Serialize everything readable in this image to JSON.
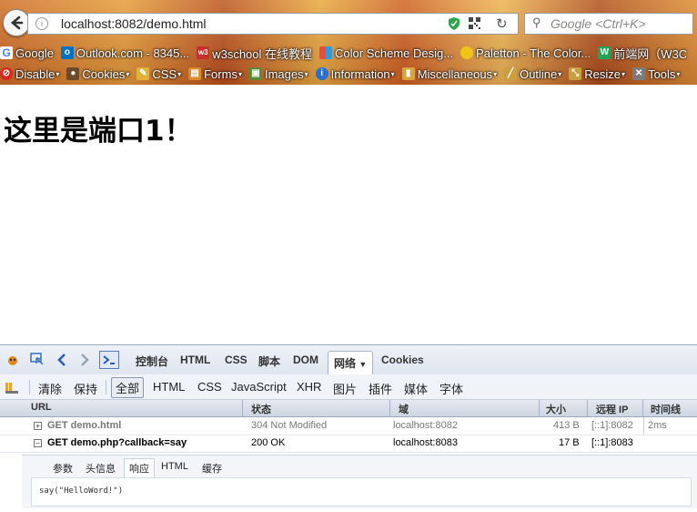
{
  "browser": {
    "url": "localhost:8082/demo.html",
    "search_placeholder": "Google <Ctrl+K>",
    "bookmarks": [
      {
        "label": "Google",
        "icon": "google-icon",
        "color": "#4285f4"
      },
      {
        "label": "Outlook.com - 8345...",
        "icon": "outlook-icon",
        "color": "#0072c6"
      },
      {
        "label": "w3school 在线教程",
        "icon": "w3school-icon",
        "color": "#c4302b"
      },
      {
        "label": "Color Scheme Desig...",
        "icon": "color-scheme-icon",
        "color": "#e84c3d"
      },
      {
        "label": "Paletton - The Color...",
        "icon": "paletton-icon",
        "color": "#f0c419"
      },
      {
        "label": "前端网（W3C",
        "icon": "w3cfuns-icon",
        "color": "#22a35a"
      }
    ],
    "webdev_toolbar": [
      {
        "label": "Disable",
        "icon": "disable-icon"
      },
      {
        "label": "Cookies",
        "icon": "cookies-icon"
      },
      {
        "label": "CSS",
        "icon": "css-icon"
      },
      {
        "label": "Forms",
        "icon": "forms-icon"
      },
      {
        "label": "Images",
        "icon": "images-icon"
      },
      {
        "label": "Information",
        "icon": "information-icon"
      },
      {
        "label": "Miscellaneous",
        "icon": "miscellaneous-icon"
      },
      {
        "label": "Outline",
        "icon": "outline-icon"
      },
      {
        "label": "Resize",
        "icon": "resize-icon"
      },
      {
        "label": "Tools",
        "icon": "tools-icon"
      }
    ]
  },
  "page": {
    "heading": "这里是端口1！"
  },
  "firebug": {
    "tabs": [
      "控制台",
      "HTML",
      "CSS",
      "脚本",
      "DOM",
      "网络",
      "Cookies"
    ],
    "active_tab": "网络",
    "filters": [
      "清除",
      "保持",
      "全部",
      "HTML",
      "CSS",
      "JavaScript",
      "XHR",
      "图片",
      "插件",
      "媒体",
      "字体"
    ],
    "active_filter": "全部",
    "columns": [
      "URL",
      "状态",
      "域",
      "大小",
      "远程 IP",
      "时间线"
    ],
    "requests": [
      {
        "url": "GET demo.html",
        "status": "304 Not Modified",
        "domain": "localhost:8082",
        "size": "413 B",
        "remote_ip": "[::1]:8082",
        "time": "2ms",
        "expanded": false
      },
      {
        "url": "GET demo.php?callback=say",
        "status": "200 OK",
        "domain": "localhost:8083",
        "size": "17 B",
        "remote_ip": "[::1]:8083",
        "time": "",
        "expanded": true
      }
    ],
    "response_tabs": [
      "参数",
      "头信息",
      "响应",
      "HTML",
      "缓存"
    ],
    "active_response_tab": "响应",
    "response_body": "say(\"HelloWord!\")"
  }
}
